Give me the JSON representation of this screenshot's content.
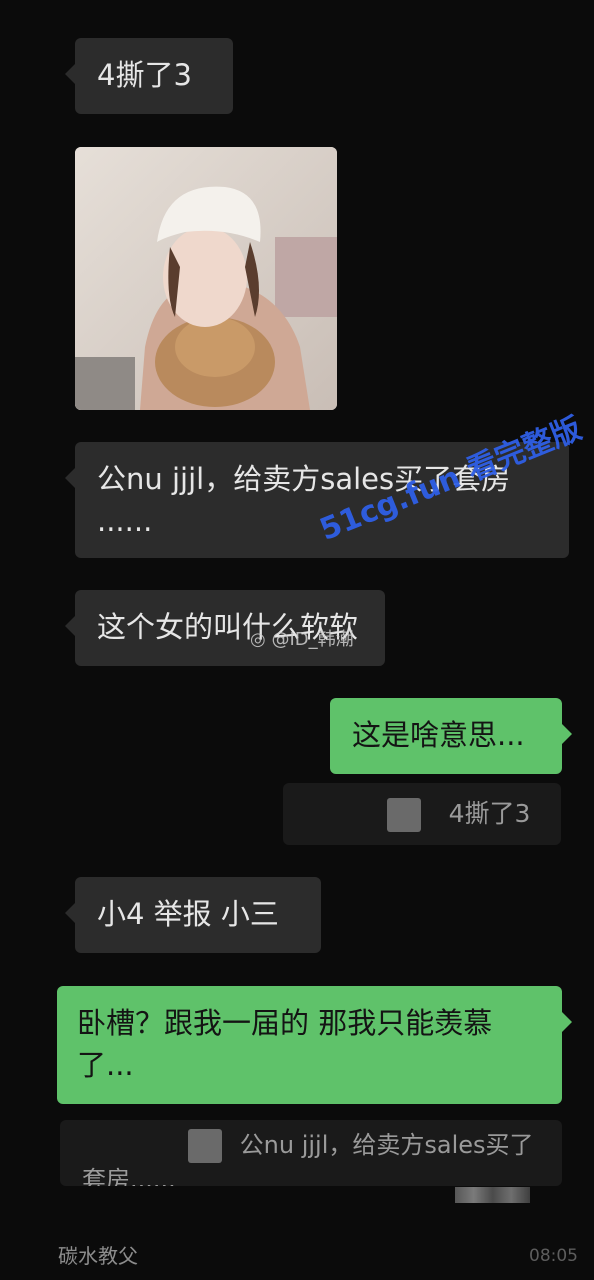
{
  "chat": {
    "messages": [
      {
        "side": "left",
        "text": "4撕了3"
      },
      {
        "side": "left",
        "type": "image"
      },
      {
        "side": "left",
        "text_line1": "公nu jjjl，给卖方sales买了套房",
        "text_line2": "......"
      },
      {
        "side": "left",
        "text": "这个女的叫什么软软"
      },
      {
        "side": "right",
        "text": "这是啥意思..."
      },
      {
        "side": "quote",
        "text": "4撕了3"
      },
      {
        "side": "left",
        "text": "小4 举报 小三"
      },
      {
        "side": "right",
        "text_line1": "卧槽？跟我一届的 那我只能羡慕",
        "text_line2": "了..."
      },
      {
        "side": "quote",
        "text_line1": "公nu jjjl，给卖方sales买了",
        "text_line2": "套房......"
      }
    ]
  },
  "watermarks": {
    "weibo": "@ID_韩潮",
    "site": "51cg.fun 看完整版"
  },
  "footer": {
    "name": "碳水教父",
    "time": "08:05"
  },
  "colors": {
    "background": "#0b0b0b",
    "left_bubble": "#2c2c2c",
    "right_bubble": "#5fc26a",
    "watermark_blue": "#2f5fe6"
  }
}
